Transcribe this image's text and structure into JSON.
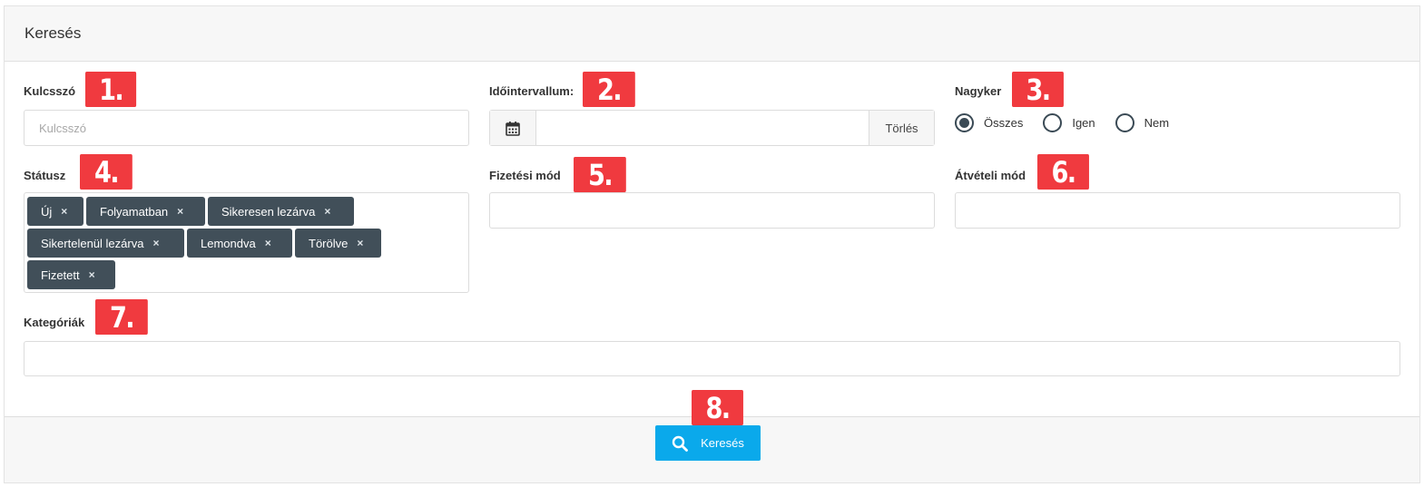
{
  "panel": {
    "title": "Keresés"
  },
  "fields": {
    "keyword": {
      "label": "Kulcsszó",
      "placeholder": "Kulcsszó",
      "value": ""
    },
    "date_range": {
      "label": "Időintervallum:",
      "value": "",
      "clear_label": "Törlés"
    },
    "wholesale": {
      "label": "Nagyker",
      "options": [
        "Összes",
        "Igen",
        "Nem"
      ],
      "selected": "Összes"
    },
    "status": {
      "label": "Státusz",
      "tags": [
        "Új",
        "Folyamatban",
        "Sikeresen lezárva",
        "Sikertelenül lezárva",
        "Lemondva",
        "Törölve",
        "Fizetett"
      ],
      "remove_symbol": "×"
    },
    "payment_method": {
      "label": "Fizetési mód",
      "value": ""
    },
    "shipping_method": {
      "label": "Átvételi mód",
      "value": ""
    },
    "categories": {
      "label": "Kategóriák",
      "value": ""
    }
  },
  "annotations": [
    "1.",
    "2.",
    "3.",
    "4.",
    "5.",
    "6.",
    "7.",
    "8."
  ],
  "footer": {
    "search_label": "Keresés"
  },
  "colors": {
    "badge": "#f03a3f",
    "tag_bg": "#414f59",
    "primary_button": "#0aa9eb"
  },
  "icons": {
    "date_addon": "calendar-icon",
    "search_button": "search-icon",
    "tag_remove": "close-icon"
  }
}
